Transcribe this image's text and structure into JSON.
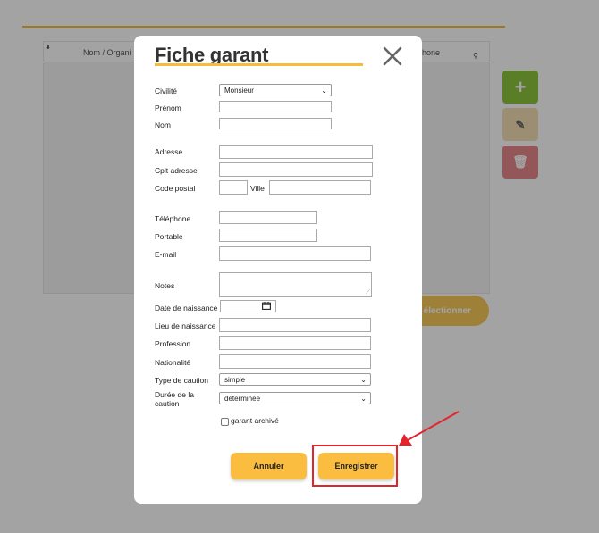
{
  "background": {
    "table_columns": {
      "name": "Nom / Organi",
      "phone": "phone"
    },
    "select_button_label": "électionner",
    "side_buttons": {
      "add": "+",
      "edit": "✎",
      "delete": "🗑"
    }
  },
  "modal": {
    "title": "Fiche garant",
    "fields": {
      "civilite": {
        "label": "Civilité",
        "value": "Monsieur"
      },
      "prenom": {
        "label": "Prénom",
        "value": ""
      },
      "nom": {
        "label": "Nom",
        "value": ""
      },
      "adresse": {
        "label": "Adresse",
        "value": ""
      },
      "cplt_adresse": {
        "label": "Cplt adresse",
        "value": ""
      },
      "code_postal": {
        "label": "Code postal",
        "value": ""
      },
      "ville": {
        "label": "Ville",
        "value": ""
      },
      "telephone": {
        "label": "Téléphone",
        "value": ""
      },
      "portable": {
        "label": "Portable",
        "value": ""
      },
      "email": {
        "label": "E-mail",
        "value": ""
      },
      "notes": {
        "label": "Notes",
        "value": ""
      },
      "date_naissance": {
        "label": "Date de naissance",
        "value": ""
      },
      "lieu_naissance": {
        "label": "Lieu de naissance",
        "value": ""
      },
      "profession": {
        "label": "Profession",
        "value": ""
      },
      "nationalite": {
        "label": "Nationalité",
        "value": ""
      },
      "type_caution": {
        "label": "Type de caution",
        "value": "simple"
      },
      "duree_caution": {
        "label_line1": "Durée de la",
        "label_line2": "caution",
        "value": "déterminée"
      }
    },
    "archived_checkbox": {
      "label": "garant archivé",
      "checked": false
    },
    "buttons": {
      "cancel": "Annuler",
      "save": "Enregistrer"
    }
  },
  "colors": {
    "accent": "#fbbd3f",
    "title_underline": "#f5bd3b",
    "add": "#8dc63f",
    "delete": "#e6888c",
    "annotation": "#e3242b"
  },
  "icons": {
    "close": "close-icon",
    "calendar": "calendar-icon",
    "dropdown": "chevron-down-icon"
  }
}
